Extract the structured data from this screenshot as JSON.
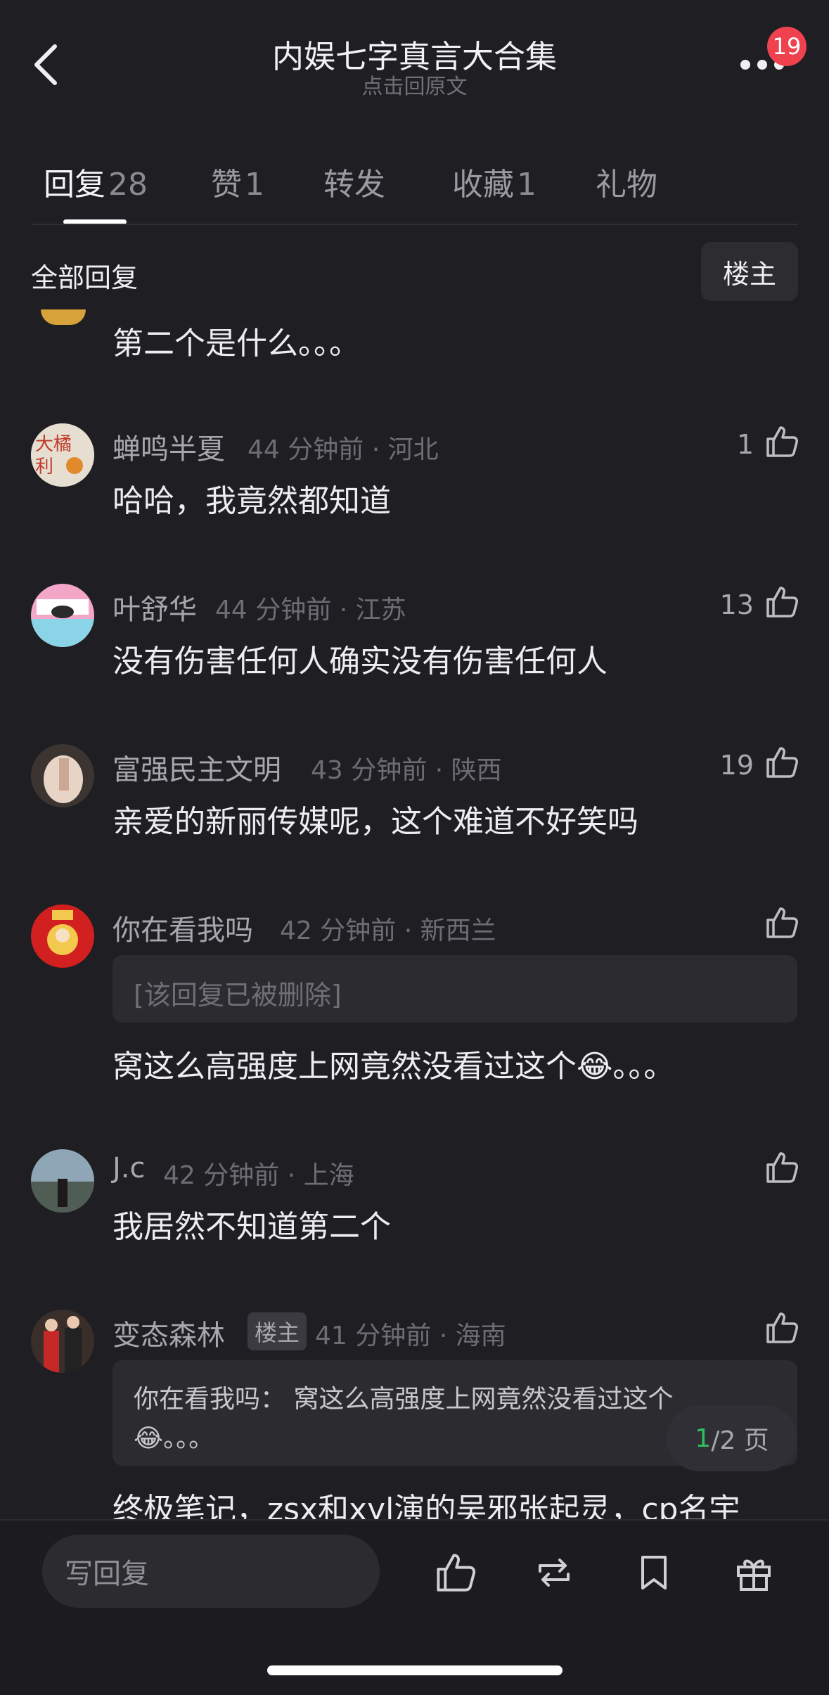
{
  "header": {
    "title": "内娱七字真言大合集",
    "subtitle": "点击回原文",
    "badge": "19"
  },
  "tabs": [
    {
      "label": "回复",
      "count": "28"
    },
    {
      "label": "赞",
      "count": "1"
    },
    {
      "label": "转发",
      "count": ""
    },
    {
      "label": "收藏",
      "count": "1"
    },
    {
      "label": "礼物",
      "count": ""
    }
  ],
  "section": {
    "title": "全部回复",
    "op_filter": "楼主"
  },
  "partial_comment": {
    "text": "第二个是什么。。。"
  },
  "comments": [
    {
      "name": "蝉鸣半夏",
      "meta": "44 分钟前 · 河北",
      "likes": "1",
      "text": "哈哈，我竟然都知道"
    },
    {
      "name": "叶舒华",
      "meta": "44 分钟前 · 江苏",
      "likes": "13",
      "text": "没有伤害任何人确实没有伤害任何人"
    },
    {
      "name": "富强民主文明",
      "meta": "43 分钟前 · 陕西",
      "likes": "19",
      "text": "亲爱的新丽传媒呢，这个难道不好笑吗"
    },
    {
      "name": "你在看我吗",
      "meta": "42 分钟前 · 新西兰",
      "likes": "",
      "quote": "[该回复已被删除]",
      "text": "窝这么高强度上网竟然没看过这个😂。。。"
    },
    {
      "name": "J.c",
      "meta": "42 分钟前 · 上海",
      "likes": "",
      "text": "我居然不知道第二个"
    },
    {
      "name": "变态森林",
      "tag": "楼主",
      "meta": "41 分钟前 · 海南",
      "likes": "",
      "quote_line1": "你在看我吗：  窝这么高强度上网竟然没看过这个",
      "quote_line2": "😂。。。",
      "text": "终极笔记，zsx和xyl演的吴邪张起灵，cp名宇"
    }
  ],
  "pager": {
    "current": "1",
    "rest": "/2 页"
  },
  "bottom_bar": {
    "placeholder": "写回复",
    "icons": [
      "thumb-up-icon",
      "repost-icon",
      "bookmark-icon",
      "gift-icon"
    ]
  },
  "colors": {
    "background": "#1f1f23",
    "badge": "#f0414e",
    "pager_current": "#2fbf5f"
  }
}
